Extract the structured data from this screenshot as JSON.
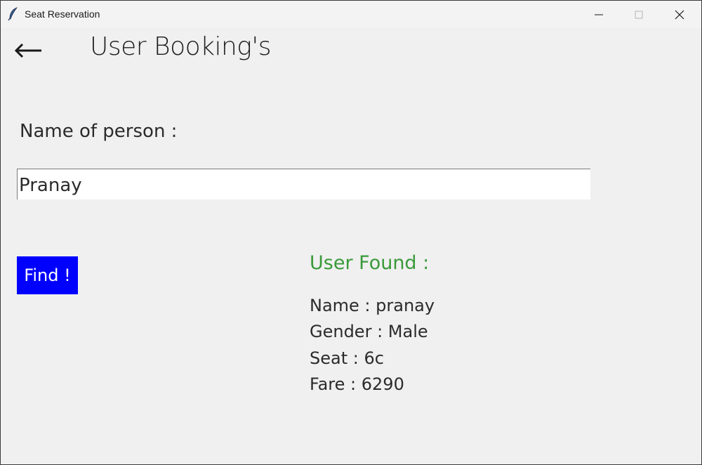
{
  "window": {
    "title": "Seat Reservation",
    "app_icon": "feather-icon"
  },
  "header": {
    "back_icon": "back-arrow-icon",
    "title": "User Booking's"
  },
  "form": {
    "name_label": "Name of person :",
    "name_value": "Pranay",
    "find_label": "Find !"
  },
  "result": {
    "heading": "User Found :",
    "name": "Name : pranay",
    "gender": "Gender : Male",
    "seat": "Seat : 6c",
    "fare": "Fare : 6290"
  },
  "colors": {
    "background": "#f0f0f0",
    "find_button": "#0000ff",
    "found_text": "#3a9a3a"
  }
}
